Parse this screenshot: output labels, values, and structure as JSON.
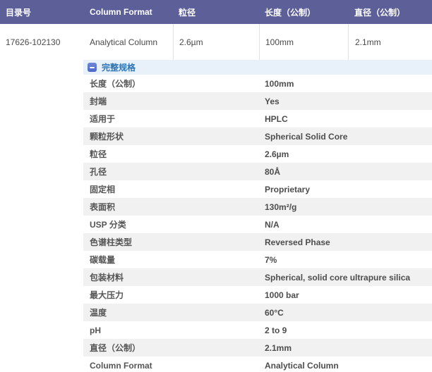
{
  "table": {
    "headers": [
      "目录号",
      "Column Format",
      "粒径",
      "长度（公制）",
      "直径（公制）"
    ],
    "row": {
      "catalog_number": "17626-102130",
      "column_format": "Analytical Column",
      "particle_size": "2.6µm",
      "length_metric": "100mm",
      "diameter_metric": "2.1mm"
    }
  },
  "details": {
    "toggle_label": "完整规格",
    "toggle_icon": "minus-square-icon",
    "expanded": true,
    "specs": [
      {
        "label": "长度（公制）",
        "value": "100mm"
      },
      {
        "label": "封端",
        "value": "Yes"
      },
      {
        "label": "适用于",
        "value": "HPLC"
      },
      {
        "label": "颗粒形状",
        "value": "Spherical Solid Core"
      },
      {
        "label": "粒径",
        "value": "2.6µm"
      },
      {
        "label": "孔径",
        "value": "80Å"
      },
      {
        "label": "固定相",
        "value": "Proprietary"
      },
      {
        "label": "表面积",
        "value": "130m²/g"
      },
      {
        "label": "USP 分类",
        "value": "N/A"
      },
      {
        "label": "色谱柱类型",
        "value": "Reversed Phase"
      },
      {
        "label": "碳载量",
        "value": "7%"
      },
      {
        "label": "包装材料",
        "value": "Spherical, solid core ultrapure silica"
      },
      {
        "label": "最大压力",
        "value": "1000 bar"
      },
      {
        "label": "温度",
        "value": "60°C"
      },
      {
        "label": "pH",
        "value": "2 to 9"
      },
      {
        "label": "直径（公制）",
        "value": "2.1mm"
      },
      {
        "label": "Column Format",
        "value": "Analytical Column"
      }
    ]
  },
  "colors": {
    "header_bg": "#5d5f99",
    "header_text": "#ffffff",
    "toggle_bar_bg": "#e8f1f9",
    "toggle_icon_bg": "#5873cd",
    "toggle_label_text": "#2e75b5",
    "alt_row_bg": "#f1f1f1",
    "body_text": "#4a4a4a",
    "cell_divider": "#e2e2e2"
  }
}
